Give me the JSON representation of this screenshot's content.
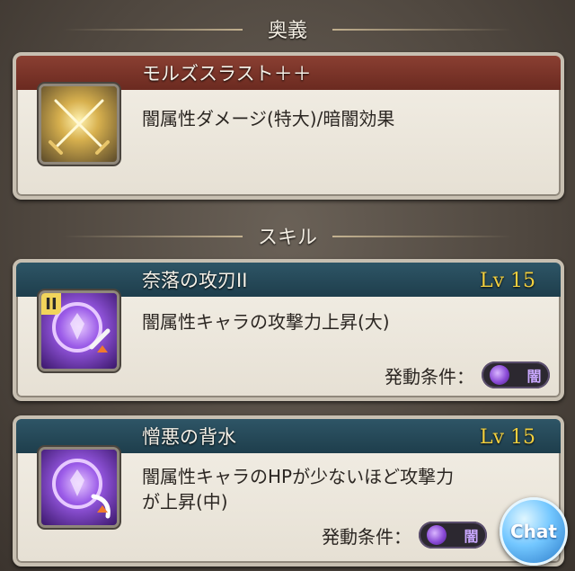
{
  "sections": {
    "ougi": "奥義",
    "skill": "スキル"
  },
  "ougi_card": {
    "title": "モルズスラスト＋＋",
    "description": "闇属性ダメージ(特大)/暗闇効果",
    "icon": "crossed-swords-icon"
  },
  "skills": [
    {
      "title": "奈落の攻刃II",
      "level": "Lv 15",
      "description": "闇属性キャラの攻撃力上昇(大)",
      "condition_label": "発動条件：",
      "condition_value": "闇",
      "icon": "dark-orb-sword-up-icon",
      "badge": "II"
    },
    {
      "title": "憎悪の背水",
      "level": "Lv 15",
      "description_line1": "闇属性キャラのHPが少ないほど攻撃力",
      "description_line2": "が上昇(中)",
      "condition_label": "発動条件：",
      "condition_value": "闇",
      "icon": "dark-orb-claw-up-icon"
    }
  ],
  "chat_button": "Chat",
  "colors": {
    "ougi_header": "#7a3529",
    "skill_header": "#28495a",
    "level_text": "#f2cf3e",
    "card_bg": "#efeae1"
  }
}
